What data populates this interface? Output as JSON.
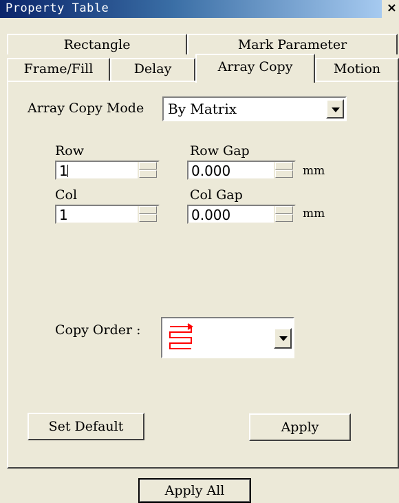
{
  "window": {
    "title": "Property Table",
    "close": "×"
  },
  "tabs": {
    "row1": [
      "Rectangle",
      "Mark Parameter"
    ],
    "row2": [
      "Frame/Fill",
      "Delay",
      "Array Copy",
      "Motion"
    ],
    "active": "Array Copy"
  },
  "array_copy": {
    "mode_label": "Array Copy Mode",
    "mode_value": "By Matrix",
    "row_label": "Row",
    "row_value": "1",
    "row_gap_label": "Row Gap",
    "row_gap_value": "0.000",
    "col_label": "Col",
    "col_value": "1",
    "col_gap_label": "Col Gap",
    "col_gap_value": "0.000",
    "unit": "mm",
    "copy_order_label": "Copy Order :",
    "copy_order_icon": "serpentine-order-icon",
    "copy_order_icon_color": "#ff0000"
  },
  "buttons": {
    "set_default": "Set Default",
    "apply": "Apply",
    "apply_all": "Apply All"
  }
}
